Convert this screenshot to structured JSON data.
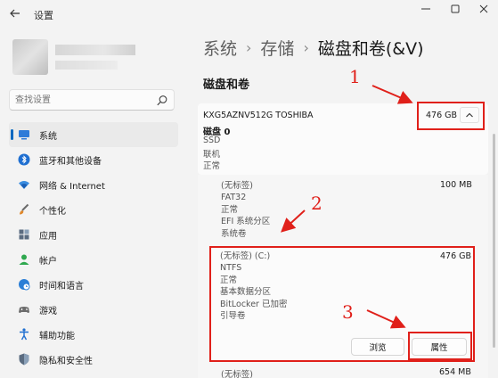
{
  "window": {
    "title": "设置",
    "back_icon": "back-arrow-icon",
    "controls": [
      "minimize-icon",
      "maximize-icon",
      "close-icon"
    ]
  },
  "search": {
    "placeholder": "查找设置",
    "icon": "search-icon"
  },
  "sidebar": {
    "items": [
      {
        "label": "系统",
        "icon": "monitor-icon",
        "active": true
      },
      {
        "label": "蓝牙和其他设备",
        "icon": "bluetooth-icon"
      },
      {
        "label": "网络 & Internet",
        "icon": "wifi-icon"
      },
      {
        "label": "个性化",
        "icon": "brush-icon"
      },
      {
        "label": "应用",
        "icon": "apps-icon"
      },
      {
        "label": "帐户",
        "icon": "account-icon"
      },
      {
        "label": "时间和语言",
        "icon": "clock-globe-icon"
      },
      {
        "label": "游戏",
        "icon": "gamepad-icon"
      },
      {
        "label": "辅助功能",
        "icon": "accessibility-icon"
      },
      {
        "label": "隐私和安全性",
        "icon": "shield-icon"
      }
    ]
  },
  "breadcrumb": {
    "parts": [
      "系统",
      "存储"
    ],
    "separator": "›",
    "current": "磁盘和卷(&V)"
  },
  "section_title": "磁盘和卷",
  "disk": {
    "model": "KXG5AZNV512G TOSHIBA",
    "name": "磁盘 0",
    "details": [
      "SSD",
      "联机",
      "正常"
    ],
    "size": "476 GB",
    "collapse_icon": "chevron-up-icon"
  },
  "partitions": [
    {
      "label": "(无标签)",
      "details": [
        "FAT32",
        "正常",
        "EFI 系统分区",
        "系统卷"
      ],
      "size": "100 MB"
    },
    {
      "label": "(无标签) (C:)",
      "details": [
        "NTFS",
        "正常",
        "基本数据分区",
        "BitLocker 已加密",
        "引导卷"
      ],
      "size": "476 GB",
      "buttons": {
        "browse": "浏览",
        "properties": "属性"
      }
    },
    {
      "label": "(无标签)",
      "size": "654 MB"
    }
  ],
  "annotations": {
    "numbers": [
      "1",
      "2",
      "3"
    ],
    "color": "#e0201a"
  },
  "colors": {
    "accent": "#0067c0",
    "background": "#f3f3f3",
    "card": "#fbfbfb"
  }
}
